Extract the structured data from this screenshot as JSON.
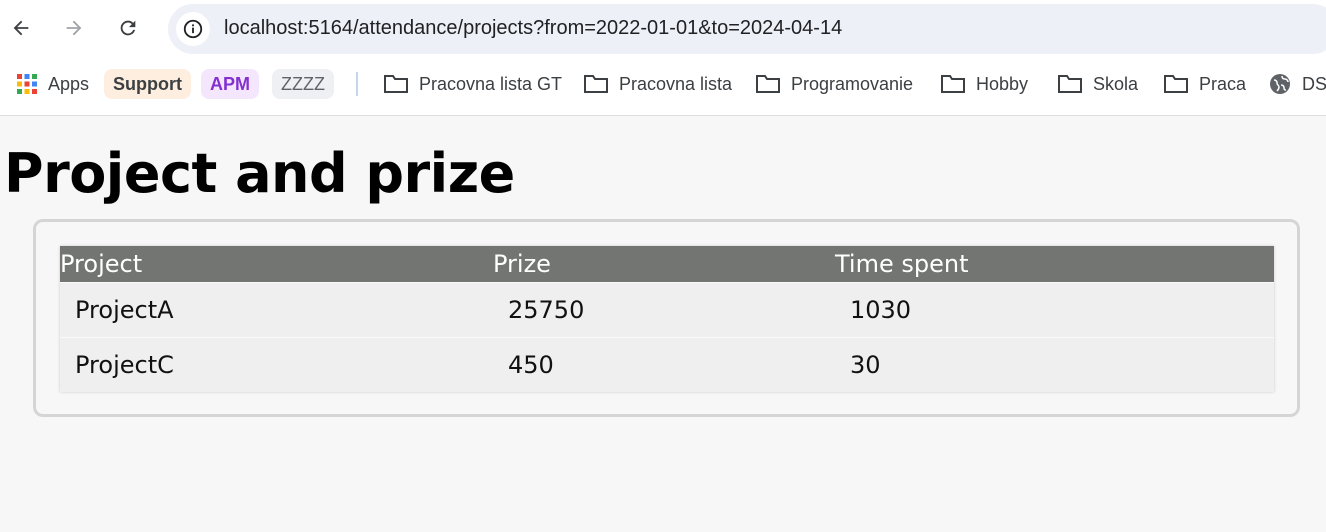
{
  "browser": {
    "url": "localhost:5164/attendance/projects?from=2022-01-01&to=2024-04-14",
    "bookmarks": {
      "apps": "Apps",
      "support": "Support",
      "apm": "APM",
      "zzzz": "ZZZZ",
      "folders": [
        "Pracovna lista GT",
        "Pracovna lista",
        "Programovanie",
        "Hobby",
        "Skola",
        "Praca"
      ],
      "dsi": "DSI"
    }
  },
  "page": {
    "title": "Project and prize",
    "table": {
      "headers": [
        "Project",
        "Prize",
        "Time spent"
      ],
      "rows": [
        [
          "ProjectA",
          "25750",
          "1030"
        ],
        [
          "ProjectC",
          "450",
          "30"
        ]
      ]
    }
  },
  "colors": {
    "header_bg": "#737572",
    "support_chip": "#fdeee0",
    "apm_chip": "#f3e6fd",
    "zzzz_chip": "#eef0f3"
  }
}
